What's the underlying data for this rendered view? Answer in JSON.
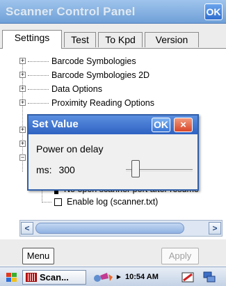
{
  "window": {
    "title": "Scanner Control Panel",
    "ok_label": "OK"
  },
  "tabs": [
    {
      "label": "Settings",
      "active": true
    },
    {
      "label": "Test",
      "active": false
    },
    {
      "label": "To Kpd",
      "active": false
    },
    {
      "label": "Version",
      "active": false
    }
  ],
  "tree": {
    "items": [
      {
        "label": "Barcode Symbologies",
        "expander": "+"
      },
      {
        "label": "Barcode Symbologies 2D",
        "expander": "+"
      },
      {
        "label": "Data Options",
        "expander": "+"
      },
      {
        "label": "Proximity Reading Options",
        "expander": "+"
      }
    ],
    "partial_item": "No open scanner port after resume",
    "log_item": {
      "label": "Enable log (scanner.txt)",
      "checked": false
    },
    "expander_plus": "+",
    "expander_minus": "−"
  },
  "scrollbar": {
    "left_arrow": "<",
    "right_arrow": ">"
  },
  "buttons": {
    "menu": "Menu",
    "apply": "Apply"
  },
  "taskbar": {
    "app_label": "Scan...",
    "time": "10:54 AM",
    "tray_arrow": "▸"
  },
  "dialog": {
    "title": "Set Value",
    "ok_label": "OK",
    "close_label": "×",
    "label": "Power on delay",
    "ms_label": "ms:",
    "value": "300",
    "slider_position": 0.1
  },
  "colors": {
    "titlebar": "#6fa0d8",
    "dialog_title": "#2e62c2",
    "close_button": "#d8452a"
  }
}
